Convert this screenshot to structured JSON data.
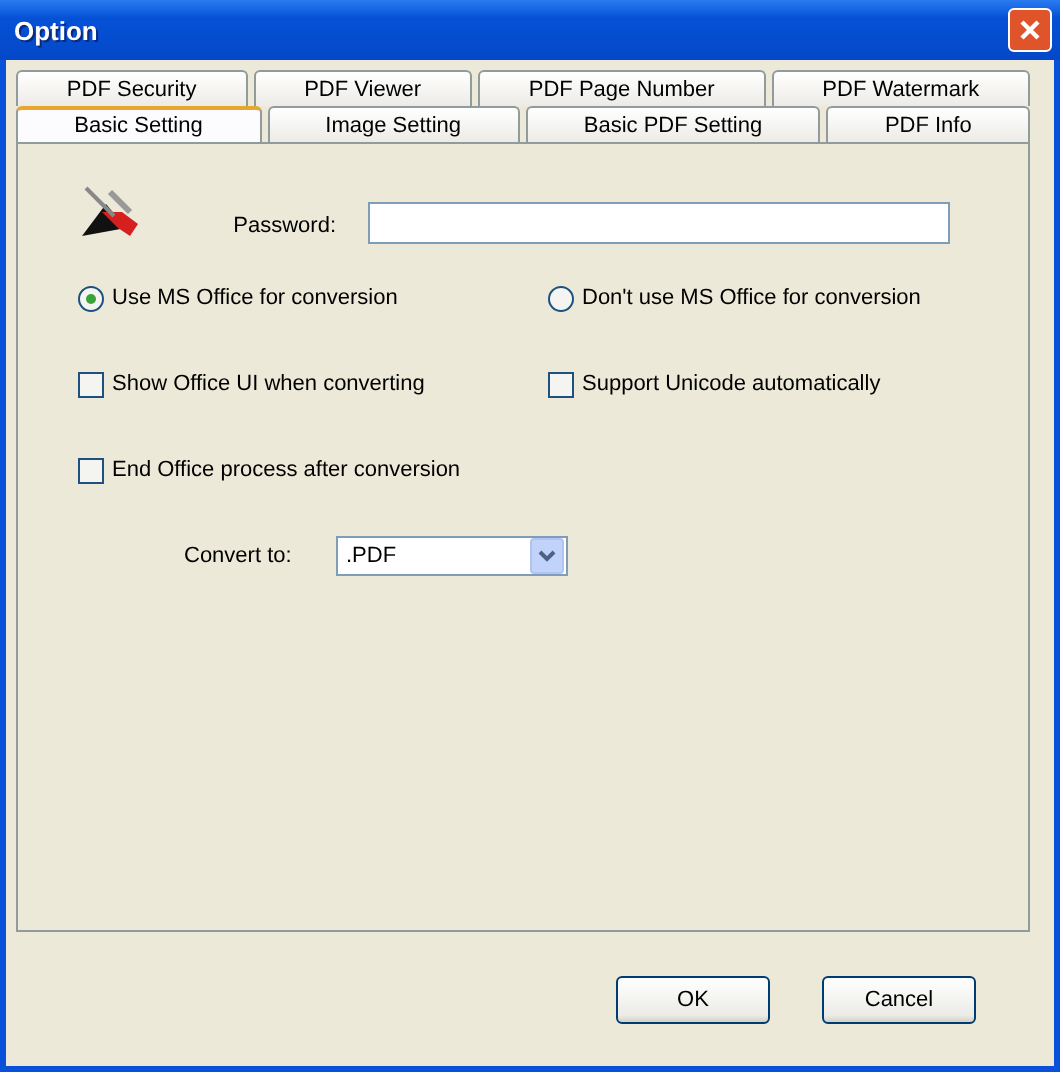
{
  "window": {
    "title": "Option"
  },
  "tab_rows": [
    [
      {
        "label": "PDF Security",
        "selected": false
      },
      {
        "label": "PDF Viewer",
        "selected": false
      },
      {
        "label": "PDF Page Number",
        "selected": false
      },
      {
        "label": "PDF Watermark",
        "selected": false
      }
    ],
    [
      {
        "label": "Basic Setting",
        "selected": true
      },
      {
        "label": "Image Setting",
        "selected": false
      },
      {
        "label": "Basic PDF Setting",
        "selected": false
      },
      {
        "label": "PDF Info",
        "selected": false
      }
    ]
  ],
  "password": {
    "label": "Password:"
  },
  "conversion_options": [
    {
      "label": "Use MS Office for conversion",
      "selected": true
    },
    {
      "label": "Don't use MS Office for conversion",
      "selected": false
    }
  ],
  "checkboxes": [
    {
      "label": "Show Office UI when converting",
      "checked": false
    },
    {
      "label": "Support Unicode automatically",
      "checked": false
    },
    {
      "label": "End Office process after conversion",
      "checked": false
    }
  ],
  "convert_to": {
    "label": "Convert to:",
    "value": ".PDF"
  },
  "buttons": [
    "OK",
    "Cancel"
  ]
}
